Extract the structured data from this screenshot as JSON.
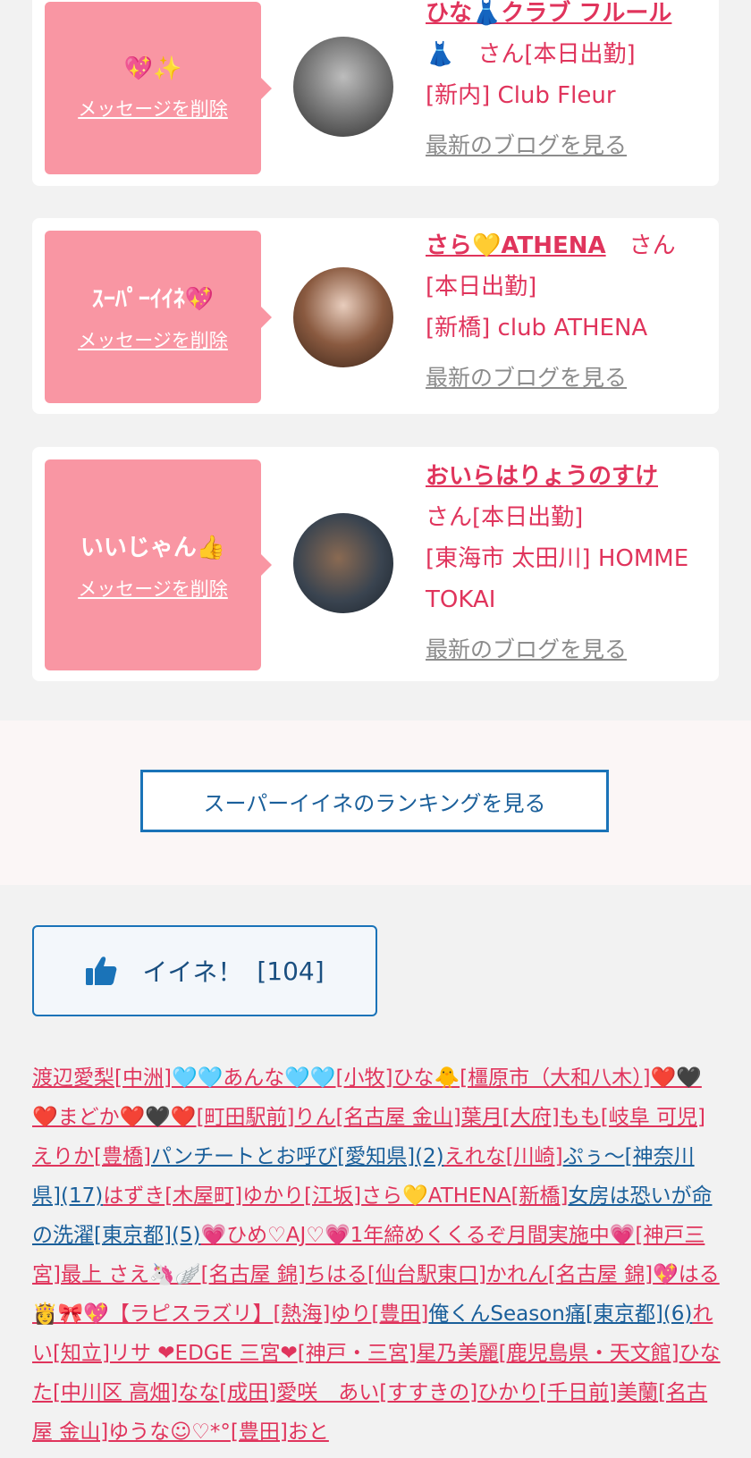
{
  "cards": [
    {
      "message": "💖✨",
      "delete_label": "メッセージを削除",
      "name": "ひな👗クラブ フルール",
      "suffix": "👗　さん[本日出勤]",
      "store": "[新内] Club Fleur",
      "blog_label": "最新のブログを見る",
      "avatar_bg": "#6e6e6e"
    },
    {
      "message": "ｽｰﾊﾟｰｲｲﾈ💖",
      "delete_label": "メッセージを削除",
      "name": "さら💛ATHENA",
      "suffix": "　さん",
      "status": "[本日出勤]",
      "store": "[新橋] club ATHENA",
      "blog_label": "最新のブログを見る",
      "avatar_bg": "#5a3a2a"
    },
    {
      "message": "いいじゃん👍",
      "delete_label": "メッセージを削除",
      "name": "おいらはりょうのすけ",
      "suffix": "さん[本日出勤]",
      "store": "[東海市 太田川] HOMME TOKAI",
      "blog_label": "最新のブログを見る",
      "avatar_bg": "#2b3440"
    }
  ],
  "ranking_button": "スーパーイイネのランキングを見る",
  "like_button": {
    "icon": "thumbs-up-icon",
    "label": "イイネ！",
    "count": "[104]"
  },
  "like_list": [
    {
      "t": "渡辺愛梨"
    },
    {
      "t": "[中洲]"
    },
    {
      "t": "🩵🩵あんな🩵🩵"
    },
    {
      "t": "[小牧]"
    },
    {
      "t": "ひな🐥"
    },
    {
      "t": "[橿原市（大和八木）]"
    },
    {
      "t": "❤️🖤❤️まどか❤️🖤❤️"
    },
    {
      "t": "[町田駅前]"
    },
    {
      "t": "りん"
    },
    {
      "t": "[名古屋 金山]"
    },
    {
      "t": "葉月"
    },
    {
      "t": "[大府]"
    },
    {
      "t": "もも"
    },
    {
      "t": "[岐阜 可児]"
    },
    {
      "t": "えりか"
    },
    {
      "t": "[豊橋]"
    },
    {
      "t": "パンチートとお呼び",
      "c": "blue"
    },
    {
      "t": "[愛知県]",
      "c": "blue"
    },
    {
      "t": "(2)",
      "c": "blue"
    },
    {
      "t": "えれな"
    },
    {
      "t": "[川崎]"
    },
    {
      "t": "ぷぅ〜",
      "c": "blue"
    },
    {
      "t": "[神奈川県]",
      "c": "blue"
    },
    {
      "t": "(17)",
      "c": "blue"
    },
    {
      "t": "はずき"
    },
    {
      "t": "[木屋町]"
    },
    {
      "t": "ゆかり"
    },
    {
      "t": "[江坂]"
    },
    {
      "t": "さら💛ATHENA"
    },
    {
      "t": "[新橋]"
    },
    {
      "t": "女房は恐いが命の洗濯",
      "c": "blue"
    },
    {
      "t": "[東京都]",
      "c": "blue"
    },
    {
      "t": "(5)",
      "c": "blue"
    },
    {
      "t": "💗ひめ♡AJ♡💗1年締めくくるぞ月間実施中💗"
    },
    {
      "t": "[神戸三宮]"
    },
    {
      "t": "最上 さえ🦄🪽"
    },
    {
      "t": "[名古屋 錦]"
    },
    {
      "t": "ちはる"
    },
    {
      "t": "[仙台駅東口]"
    },
    {
      "t": "かれん"
    },
    {
      "t": "[名古屋 錦]"
    },
    {
      "t": "💖はる👸🎀💖【ラピスラズリ】"
    },
    {
      "t": "[熱海]"
    },
    {
      "t": "ゆり"
    },
    {
      "t": "[豊田]"
    },
    {
      "t": "俺くんSeason痛",
      "c": "blue"
    },
    {
      "t": "[東京都]",
      "c": "blue"
    },
    {
      "t": "(6)",
      "c": "blue"
    },
    {
      "t": "れい"
    },
    {
      "t": "[知立]"
    },
    {
      "t": "リサ ❤EDGE 三宮❤"
    },
    {
      "t": "[神戸・三宮]"
    },
    {
      "t": "星乃美麗"
    },
    {
      "t": "[鹿児島県・天文館]"
    },
    {
      "t": "ひなた"
    },
    {
      "t": "[中川区 高畑]"
    },
    {
      "t": "なな"
    },
    {
      "t": "[成田]"
    },
    {
      "t": "愛咲　あい"
    },
    {
      "t": "[すすきの]"
    },
    {
      "t": "ひかり"
    },
    {
      "t": "[千日前]"
    },
    {
      "t": "美蘭"
    },
    {
      "t": "[名古屋 金山]"
    },
    {
      "t": "ゆうな☺︎♡*°"
    },
    {
      "t": "[豊田]"
    },
    {
      "t": "おと"
    }
  ]
}
